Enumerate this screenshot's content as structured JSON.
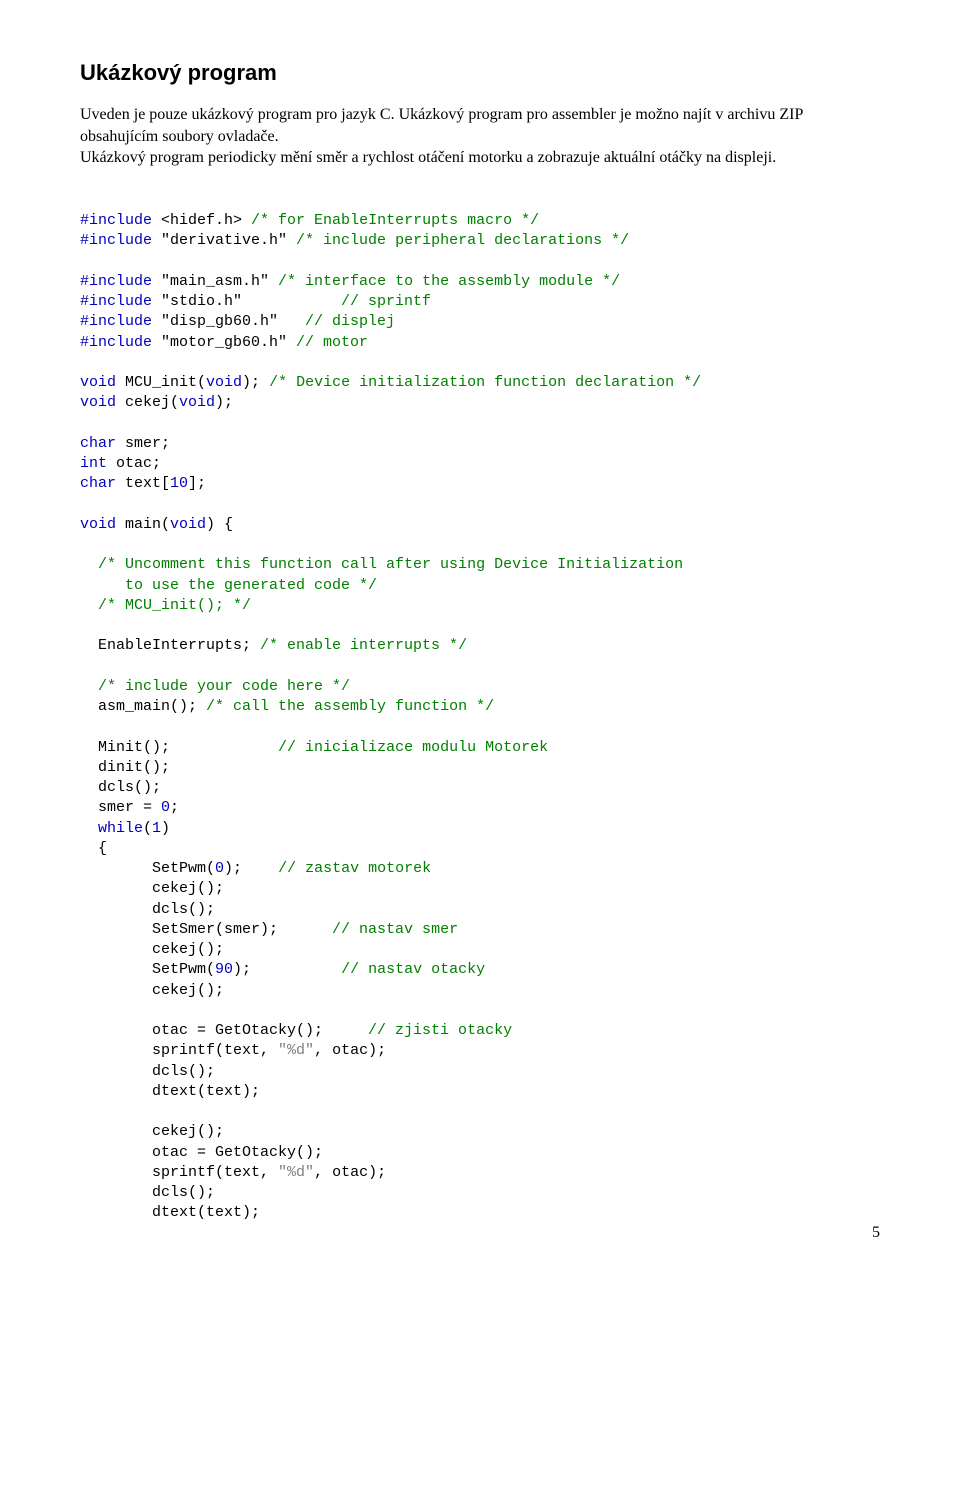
{
  "title": "Ukázkový program",
  "paragraph": "Uveden je pouze ukázkový program pro jazyk C. Ukázkový program pro assembler je možno najít v archivu ZIP obsahujícím soubory ovladače.\nUkázkový program periodicky mění směr a rychlost otáčení motorku a zobrazuje aktuální otáčky na displeji.",
  "code": {
    "inc1_kw": "#include",
    "inc1_arg": " <hidef.h> ",
    "inc1_cm": "/* for EnableInterrupts macro */",
    "inc2_kw": "#include",
    "inc2_arg": " \"derivative.h\" ",
    "inc2_cm": "/* include peripheral declarations */",
    "inc3_kw": "#include",
    "inc3_arg": " \"main_asm.h\" ",
    "inc3_cm": "/* interface to the assembly module */",
    "inc4_kw": "#include",
    "inc4_arg": " \"stdio.h\"           ",
    "inc4_cm": "// sprintf",
    "inc5_kw": "#include",
    "inc5_arg": " \"disp_gb60.h\"   ",
    "inc5_cm": "// displej",
    "inc6_kw": "#include",
    "inc6_arg": " \"motor_gb60.h\" ",
    "inc6_cm": "// motor",
    "void1": "void",
    "mcu_txt": " MCU_init(",
    "void2": "void",
    "mcu_close": "); ",
    "mcu_cm": "/* Device initialization function declaration */",
    "void3": "void",
    "cekej_txt": " cekej(",
    "void4": "void",
    "cekej_close": ");",
    "charkw1": "char",
    "smer_txt": " smer;",
    "intkw": "int",
    "otac_txt": " otac;",
    "charkw2": "char",
    "textarr": " text[",
    "ten": "10",
    "textarr_close": "];",
    "void5": "void",
    "main_txt": " main(",
    "void6": "void",
    "main_close": ") {",
    "uncomment_cm": "  /* Uncomment this function call after using Device Initialization\n     to use the generated code */\n  /* MCU_init(); */",
    "enable": "  EnableInterrupts; ",
    "enable_cm": "/* enable interrupts */",
    "inc_here_cm": "  /* include your code here */",
    "asm_main": "  asm_main(); ",
    "asm_main_cm": "/* call the assembly function */",
    "minit": "  Minit();            ",
    "minit_cm": "// inicializace modulu Motorek",
    "dinit": "  dinit();",
    "dcls0": "  dcls();",
    "smer0": "  smer = ",
    "zero": "0",
    "smer0_tail": ";",
    "whilekw": "  while",
    "while_open": "(",
    "one": "1",
    "while_close": ")",
    "brace_open": "  {",
    "setpwm0": "        SetPwm(",
    "zero2": "0",
    "setpwm0_tail": ");    ",
    "setpwm0_cm": "// zastav motorek",
    "cekej1": "        cekej();",
    "dcls1": "        dcls();",
    "setsmer": "        SetSmer(smer);      ",
    "setsmer_cm": "// nastav smer",
    "cekej2": "        cekej();",
    "setpwm90": "        SetPwm(",
    "ninety": "90",
    "setpwm90_tail": ");          ",
    "setpwm90_cm": "// nastav otacky",
    "cekej3": "        cekej();",
    "getotac1": "        otac = GetOtacky();     ",
    "getotac1_cm": "// zjisti otacky",
    "sprintf1a": "        sprintf(text, ",
    "sprintf_fmt1": "\"%d\"",
    "sprintf1b": ", otac);",
    "dcls2": "        dcls();",
    "dtext1": "        dtext(text);",
    "cekej4": "        cekej();",
    "getotac2": "        otac = GetOtacky();",
    "sprintf2a": "        sprintf(text, ",
    "sprintf_fmt2": "\"%d\"",
    "sprintf2b": ", otac);",
    "dcls3": "        dcls();",
    "dtext2": "        dtext(text);"
  },
  "page_number": "5"
}
